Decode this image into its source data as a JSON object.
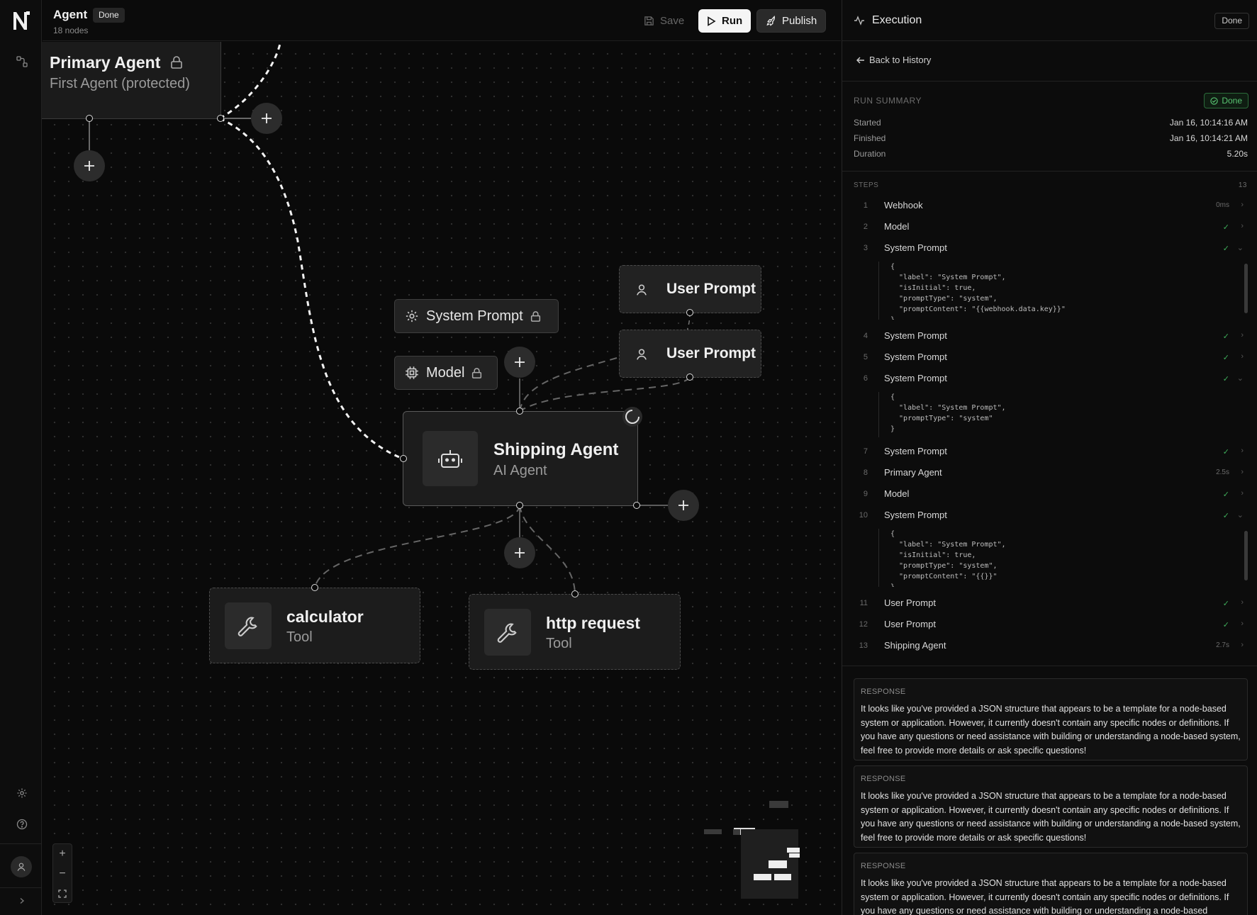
{
  "header": {
    "title": "Agent",
    "status_badge": "Done",
    "subtitle": "18 nodes",
    "save_label": "Save",
    "run_label": "Run",
    "publish_label": "Publish"
  },
  "canvas": {
    "primary_agent": {
      "title": "Primary Agent",
      "subtitle": "First Agent (protected)"
    },
    "system_prompt": {
      "label": "System Prompt"
    },
    "model": {
      "label": "Model"
    },
    "user_prompt_1": {
      "label": "User Prompt"
    },
    "user_prompt_2": {
      "label": "User Prompt"
    },
    "shipping_agent": {
      "title": "Shipping Agent",
      "subtitle": "AI Agent"
    },
    "calculator": {
      "title": "calculator",
      "subtitle": "Tool"
    },
    "http_request": {
      "title": "http request",
      "subtitle": "Tool"
    }
  },
  "panel": {
    "title": "Execution",
    "done_label": "Done",
    "back_label": "Back to History",
    "run_summary": {
      "label": "RUN SUMMARY",
      "badge": "Done",
      "started_label": "Started",
      "started": "Jan 16, 10:14:16 AM",
      "finished_label": "Finished",
      "finished": "Jan 16, 10:14:21 AM",
      "duration_label": "Duration",
      "duration": "5.20s"
    },
    "steps_label": "STEPS",
    "steps_count": "13",
    "steps": [
      {
        "num": "1",
        "label": "Webhook",
        "meta": "0ms"
      },
      {
        "num": "2",
        "label": "Model",
        "meta": ""
      },
      {
        "num": "3",
        "label": "System Prompt",
        "meta": ""
      },
      {
        "num": "4",
        "label": "System Prompt",
        "meta": ""
      },
      {
        "num": "5",
        "label": "System Prompt",
        "meta": ""
      },
      {
        "num": "6",
        "label": "System Prompt",
        "meta": ""
      },
      {
        "num": "7",
        "label": "System Prompt",
        "meta": ""
      },
      {
        "num": "8",
        "label": "Primary Agent",
        "meta": "2.5s"
      },
      {
        "num": "9",
        "label": "Model",
        "meta": ""
      },
      {
        "num": "10",
        "label": "System Prompt",
        "meta": ""
      },
      {
        "num": "11",
        "label": "User Prompt",
        "meta": ""
      },
      {
        "num": "12",
        "label": "User Prompt",
        "meta": ""
      },
      {
        "num": "13",
        "label": "Shipping Agent",
        "meta": "2.7s"
      }
    ],
    "code_3": "{\n  \"label\": \"System Prompt\",\n  \"isInitial\": true,\n  \"promptType\": \"system\",\n  \"promptContent\": \"{{webhook.data.key}}\"\n}",
    "code_6": "{\n  \"label\": \"System Prompt\",\n  \"promptType\": \"system\"\n}",
    "code_10": "{\n  \"label\": \"System Prompt\",\n  \"isInitial\": true,\n  \"promptType\": \"system\",\n  \"promptContent\": \"{{}}\"\n}",
    "responses": [
      {
        "label": "RESPONSE",
        "text": "It looks like you've provided a JSON structure that appears to be a template for a node-based system or application. However, it currently doesn't contain any specific nodes or definitions. If you have any questions or need assistance with building or understanding a node-based system, feel free to provide more details or ask specific questions!"
      },
      {
        "label": "RESPONSE",
        "text": "It looks like you've provided a JSON structure that appears to be a template for a node-based system or application. However, it currently doesn't contain any specific nodes or definitions. If you have any questions or need assistance with building or understanding a node-based system, feel free to provide more details or ask specific questions!"
      },
      {
        "label": "RESPONSE",
        "text": "It looks like you've provided a JSON structure that appears to be a template for a node-based system or application. However, it currently doesn't contain any specific nodes or definitions. If you have any questions or need assistance with building or understanding a node-based"
      }
    ]
  },
  "colors": {
    "accent_green": "#3fae5b",
    "background": "#0a0a0a",
    "node_bg": "#1a1a1a"
  }
}
